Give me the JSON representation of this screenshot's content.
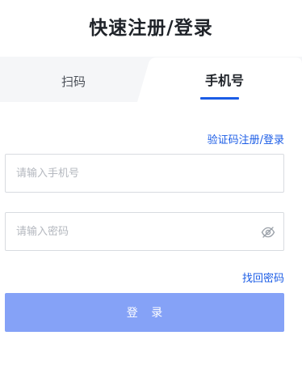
{
  "title": "快速注册/登录",
  "tabs": [
    {
      "label": "扫码",
      "active": false
    },
    {
      "label": "手机号",
      "active": true
    }
  ],
  "sms_link": "验证码注册/登录",
  "phone_input": {
    "placeholder": "请输入手机号",
    "value": ""
  },
  "password_input": {
    "placeholder": "请输入密码",
    "value": "",
    "icon": "eye-off-icon"
  },
  "forgot_link": "找回密码",
  "login_button": "登 录",
  "colors": {
    "accent": "#1b5ce6",
    "button": "#85a2f7",
    "inactive_tab_bg": "#f5f6f8",
    "border": "#d8dbe0"
  }
}
